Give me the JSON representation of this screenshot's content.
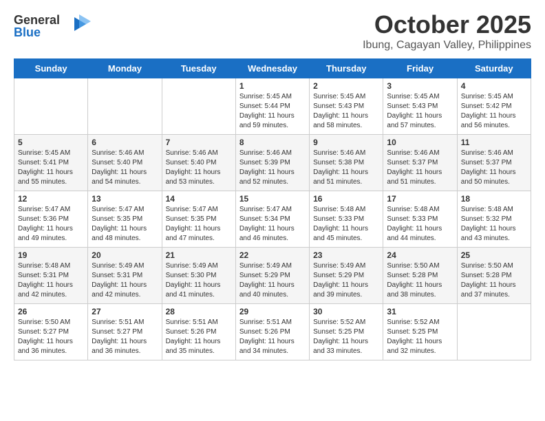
{
  "header": {
    "logo_line1": "General",
    "logo_line2": "Blue",
    "month_title": "October 2025",
    "location": "Ibung, Cagayan Valley, Philippines"
  },
  "weekdays": [
    "Sunday",
    "Monday",
    "Tuesday",
    "Wednesday",
    "Thursday",
    "Friday",
    "Saturday"
  ],
  "weeks": [
    [
      {
        "day": "",
        "sunrise": "",
        "sunset": "",
        "daylight": ""
      },
      {
        "day": "",
        "sunrise": "",
        "sunset": "",
        "daylight": ""
      },
      {
        "day": "",
        "sunrise": "",
        "sunset": "",
        "daylight": ""
      },
      {
        "day": "1",
        "sunrise": "Sunrise: 5:45 AM",
        "sunset": "Sunset: 5:44 PM",
        "daylight": "Daylight: 11 hours and 59 minutes."
      },
      {
        "day": "2",
        "sunrise": "Sunrise: 5:45 AM",
        "sunset": "Sunset: 5:43 PM",
        "daylight": "Daylight: 11 hours and 58 minutes."
      },
      {
        "day": "3",
        "sunrise": "Sunrise: 5:45 AM",
        "sunset": "Sunset: 5:43 PM",
        "daylight": "Daylight: 11 hours and 57 minutes."
      },
      {
        "day": "4",
        "sunrise": "Sunrise: 5:45 AM",
        "sunset": "Sunset: 5:42 PM",
        "daylight": "Daylight: 11 hours and 56 minutes."
      }
    ],
    [
      {
        "day": "5",
        "sunrise": "Sunrise: 5:45 AM",
        "sunset": "Sunset: 5:41 PM",
        "daylight": "Daylight: 11 hours and 55 minutes."
      },
      {
        "day": "6",
        "sunrise": "Sunrise: 5:46 AM",
        "sunset": "Sunset: 5:40 PM",
        "daylight": "Daylight: 11 hours and 54 minutes."
      },
      {
        "day": "7",
        "sunrise": "Sunrise: 5:46 AM",
        "sunset": "Sunset: 5:40 PM",
        "daylight": "Daylight: 11 hours and 53 minutes."
      },
      {
        "day": "8",
        "sunrise": "Sunrise: 5:46 AM",
        "sunset": "Sunset: 5:39 PM",
        "daylight": "Daylight: 11 hours and 52 minutes."
      },
      {
        "day": "9",
        "sunrise": "Sunrise: 5:46 AM",
        "sunset": "Sunset: 5:38 PM",
        "daylight": "Daylight: 11 hours and 51 minutes."
      },
      {
        "day": "10",
        "sunrise": "Sunrise: 5:46 AM",
        "sunset": "Sunset: 5:37 PM",
        "daylight": "Daylight: 11 hours and 51 minutes."
      },
      {
        "day": "11",
        "sunrise": "Sunrise: 5:46 AM",
        "sunset": "Sunset: 5:37 PM",
        "daylight": "Daylight: 11 hours and 50 minutes."
      }
    ],
    [
      {
        "day": "12",
        "sunrise": "Sunrise: 5:47 AM",
        "sunset": "Sunset: 5:36 PM",
        "daylight": "Daylight: 11 hours and 49 minutes."
      },
      {
        "day": "13",
        "sunrise": "Sunrise: 5:47 AM",
        "sunset": "Sunset: 5:35 PM",
        "daylight": "Daylight: 11 hours and 48 minutes."
      },
      {
        "day": "14",
        "sunrise": "Sunrise: 5:47 AM",
        "sunset": "Sunset: 5:35 PM",
        "daylight": "Daylight: 11 hours and 47 minutes."
      },
      {
        "day": "15",
        "sunrise": "Sunrise: 5:47 AM",
        "sunset": "Sunset: 5:34 PM",
        "daylight": "Daylight: 11 hours and 46 minutes."
      },
      {
        "day": "16",
        "sunrise": "Sunrise: 5:48 AM",
        "sunset": "Sunset: 5:33 PM",
        "daylight": "Daylight: 11 hours and 45 minutes."
      },
      {
        "day": "17",
        "sunrise": "Sunrise: 5:48 AM",
        "sunset": "Sunset: 5:33 PM",
        "daylight": "Daylight: 11 hours and 44 minutes."
      },
      {
        "day": "18",
        "sunrise": "Sunrise: 5:48 AM",
        "sunset": "Sunset: 5:32 PM",
        "daylight": "Daylight: 11 hours and 43 minutes."
      }
    ],
    [
      {
        "day": "19",
        "sunrise": "Sunrise: 5:48 AM",
        "sunset": "Sunset: 5:31 PM",
        "daylight": "Daylight: 11 hours and 42 minutes."
      },
      {
        "day": "20",
        "sunrise": "Sunrise: 5:49 AM",
        "sunset": "Sunset: 5:31 PM",
        "daylight": "Daylight: 11 hours and 42 minutes."
      },
      {
        "day": "21",
        "sunrise": "Sunrise: 5:49 AM",
        "sunset": "Sunset: 5:30 PM",
        "daylight": "Daylight: 11 hours and 41 minutes."
      },
      {
        "day": "22",
        "sunrise": "Sunrise: 5:49 AM",
        "sunset": "Sunset: 5:29 PM",
        "daylight": "Daylight: 11 hours and 40 minutes."
      },
      {
        "day": "23",
        "sunrise": "Sunrise: 5:49 AM",
        "sunset": "Sunset: 5:29 PM",
        "daylight": "Daylight: 11 hours and 39 minutes."
      },
      {
        "day": "24",
        "sunrise": "Sunrise: 5:50 AM",
        "sunset": "Sunset: 5:28 PM",
        "daylight": "Daylight: 11 hours and 38 minutes."
      },
      {
        "day": "25",
        "sunrise": "Sunrise: 5:50 AM",
        "sunset": "Sunset: 5:28 PM",
        "daylight": "Daylight: 11 hours and 37 minutes."
      }
    ],
    [
      {
        "day": "26",
        "sunrise": "Sunrise: 5:50 AM",
        "sunset": "Sunset: 5:27 PM",
        "daylight": "Daylight: 11 hours and 36 minutes."
      },
      {
        "day": "27",
        "sunrise": "Sunrise: 5:51 AM",
        "sunset": "Sunset: 5:27 PM",
        "daylight": "Daylight: 11 hours and 36 minutes."
      },
      {
        "day": "28",
        "sunrise": "Sunrise: 5:51 AM",
        "sunset": "Sunset: 5:26 PM",
        "daylight": "Daylight: 11 hours and 35 minutes."
      },
      {
        "day": "29",
        "sunrise": "Sunrise: 5:51 AM",
        "sunset": "Sunset: 5:26 PM",
        "daylight": "Daylight: 11 hours and 34 minutes."
      },
      {
        "day": "30",
        "sunrise": "Sunrise: 5:52 AM",
        "sunset": "Sunset: 5:25 PM",
        "daylight": "Daylight: 11 hours and 33 minutes."
      },
      {
        "day": "31",
        "sunrise": "Sunrise: 5:52 AM",
        "sunset": "Sunset: 5:25 PM",
        "daylight": "Daylight: 11 hours and 32 minutes."
      },
      {
        "day": "",
        "sunrise": "",
        "sunset": "",
        "daylight": ""
      }
    ]
  ]
}
